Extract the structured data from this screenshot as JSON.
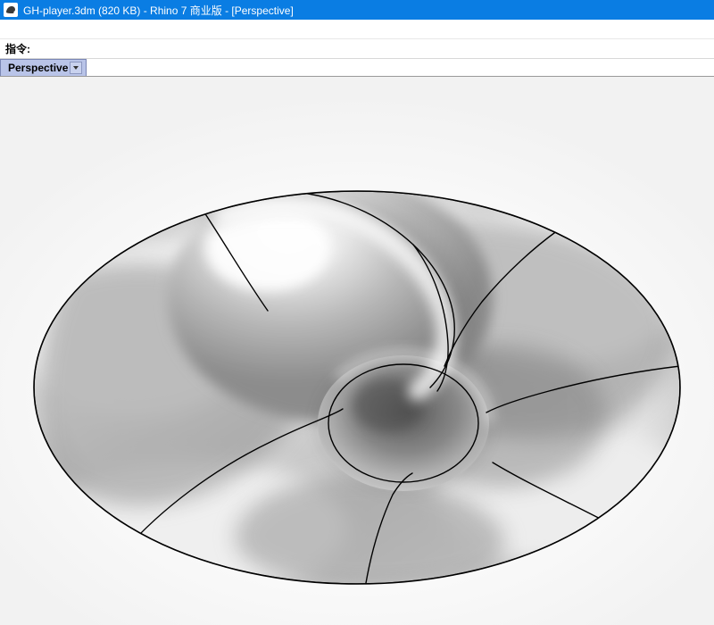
{
  "titlebar": {
    "icon_name": "rhino-icon",
    "text": "GH-player.3dm (820 KB) - Rhino 7 商业版 - [Perspective]"
  },
  "command": {
    "label": "指令:",
    "value": ""
  },
  "view_tab": {
    "label": "Perspective",
    "dropdown_icon": "chevron-down-icon"
  }
}
